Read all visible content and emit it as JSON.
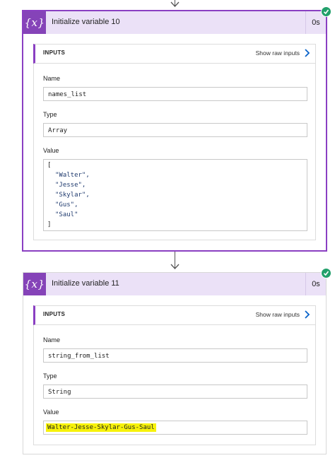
{
  "steps": [
    {
      "icon": "variable-icon",
      "icon_text": "{x}",
      "title": "Initialize variable 10",
      "duration": "0s",
      "status": "succeeded",
      "inputs_label": "INPUTS",
      "show_raw": "Show raw inputs",
      "fields": {
        "name_label": "Name",
        "name_value": "names_list",
        "type_label": "Type",
        "type_value": "Array",
        "value_label": "Value",
        "value_lines": [
          "[",
          "\"Walter\",",
          "\"Jesse\",",
          "\"Skylar\",",
          "\"Gus\",",
          "\"Saul\"",
          "]"
        ]
      }
    },
    {
      "icon": "variable-icon",
      "icon_text": "{x}",
      "title": "Initialize variable 11",
      "duration": "0s",
      "status": "succeeded",
      "inputs_label": "INPUTS",
      "show_raw": "Show raw inputs",
      "fields": {
        "name_label": "Name",
        "name_value": "string_from_list",
        "type_label": "Type",
        "type_value": "String",
        "value_label": "Value",
        "value_text": "Walter-Jesse-Skylar-Gus-Saul"
      }
    }
  ],
  "colors": {
    "accent": "#8543b8",
    "header_bg": "#ebe1f7",
    "success": "#22a06b",
    "highlight": "#f7f20a"
  }
}
